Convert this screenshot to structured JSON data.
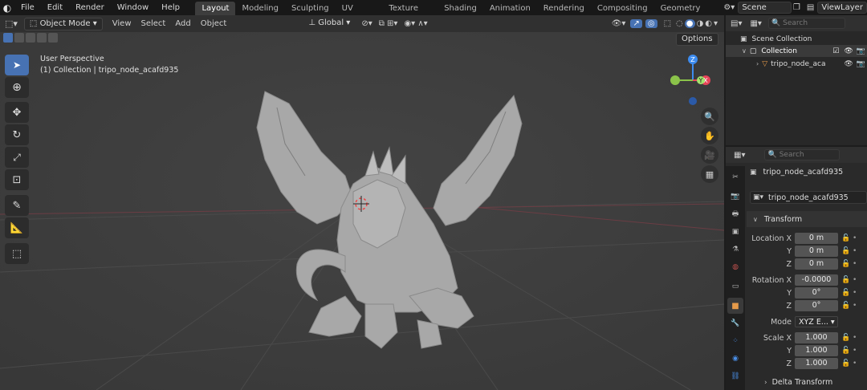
{
  "topbar": {
    "menus": [
      "File",
      "Edit",
      "Render",
      "Window",
      "Help"
    ],
    "workspaces": [
      "Layout",
      "Modeling",
      "Sculpting",
      "UV Editing",
      "Texture Paint",
      "Shading",
      "Animation",
      "Rendering",
      "Compositing",
      "Geometry Node"
    ],
    "active_workspace": "Layout",
    "scene": "Scene",
    "view_layer": "ViewLayer"
  },
  "viewport_header": {
    "mode": "Object Mode",
    "menus": [
      "View",
      "Select",
      "Add",
      "Object"
    ],
    "transform_orientation": "Global",
    "options": "Options"
  },
  "viewport": {
    "perspective_label": "User Perspective",
    "collection_label": "(1) Collection | tripo_node_acafd935",
    "gizmo": {
      "z": "Z",
      "y": "Y",
      "x": "X"
    }
  },
  "outliner": {
    "search_placeholder": "Search",
    "items": [
      {
        "label": "Scene Collection"
      },
      {
        "label": "Collection"
      },
      {
        "label": "tripo_node_aca"
      }
    ]
  },
  "properties": {
    "search_placeholder": "Search",
    "object_name": "tripo_node_acafd935",
    "data_name": "tripo_node_acafd935",
    "transform_panel": "Transform",
    "delta_panel": "Delta Transform",
    "location": {
      "label": "Location X",
      "y_label": "Y",
      "z_label": "Z",
      "x": "0 m",
      "y": "0 m",
      "z": "0 m"
    },
    "rotation": {
      "label": "Rotation X",
      "y_label": "Y",
      "z_label": "Z",
      "x": "-0.0000",
      "y": "0°",
      "z": "0°"
    },
    "mode": {
      "label": "Mode",
      "value": "XYZ E..."
    },
    "scale": {
      "label": "Scale X",
      "y_label": "Y",
      "z_label": "Z",
      "x": "1.000",
      "y": "1.000",
      "z": "1.000"
    }
  },
  "colors": {
    "accent": "#4772b3",
    "viewport_bg": "#3d3d3d",
    "axis_x": "#e8455a",
    "axis_y": "#8bc34a",
    "axis_z": "#3d8cf0"
  }
}
